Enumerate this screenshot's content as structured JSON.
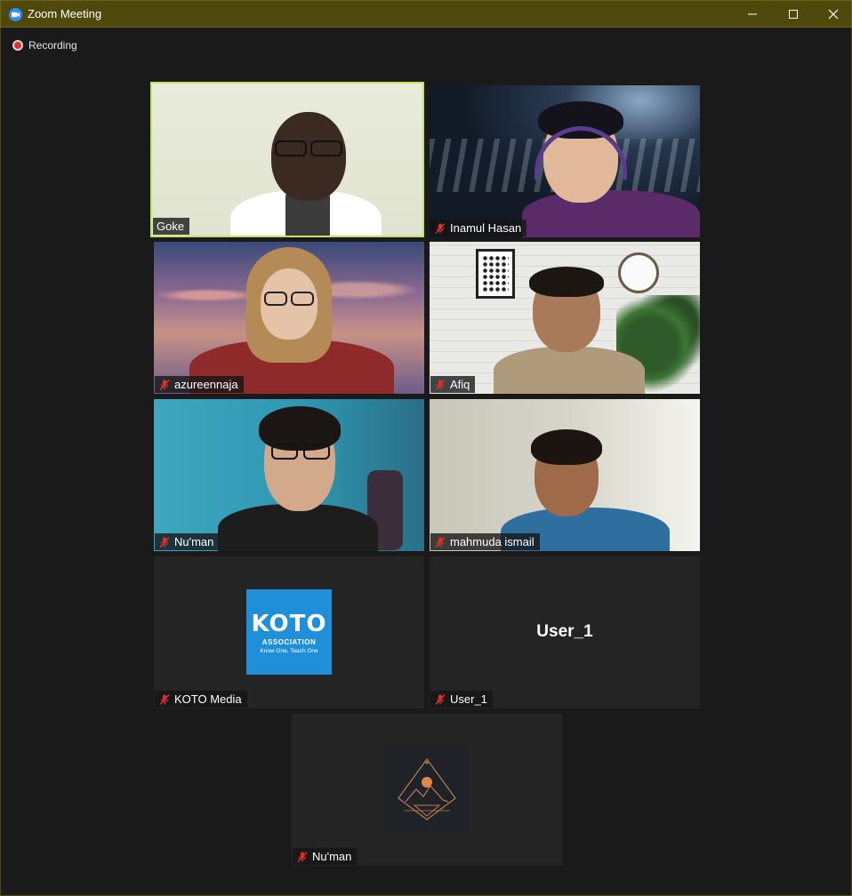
{
  "window": {
    "title": "Zoom Meeting",
    "icon": "zoom-camera-icon",
    "controls": [
      "minimize-icon",
      "maximize-icon",
      "close-icon"
    ]
  },
  "recording": {
    "label": "Recording"
  },
  "participants": [
    {
      "name": "Goke",
      "muted": false,
      "active_speaker": true,
      "video": "camera"
    },
    {
      "name": "Inamul Hasan",
      "muted": true,
      "video": "camera"
    },
    {
      "name": "azureennaja",
      "muted": true,
      "video": "camera"
    },
    {
      "name": "Afiq",
      "muted": true,
      "video": "camera"
    },
    {
      "name": "Nu'man",
      "muted": true,
      "video": "camera"
    },
    {
      "name": "mahmuda ismail",
      "muted": true,
      "video": "camera"
    },
    {
      "name": "KOTO Media",
      "muted": true,
      "video": "profile-picture",
      "logo": {
        "main": "KOTO",
        "sub": "ASSOCIATION",
        "tagline": "Know One, Teach One"
      }
    },
    {
      "name": "User_1",
      "muted": true,
      "video": "off",
      "display_name": "User_1"
    },
    {
      "name": "Nu'man",
      "muted": true,
      "video": "profile-picture",
      "logo": {
        "icon": "mountain-sun-logo-icon"
      }
    }
  ],
  "colors": {
    "titlebar": "#4f4a0b",
    "background": "#1a1a1a",
    "tile_background": "#242424",
    "active_speaker_border": "#c6e35c",
    "muted_mic": "#e02f2f",
    "koto_blue": "#1e8fd8"
  }
}
